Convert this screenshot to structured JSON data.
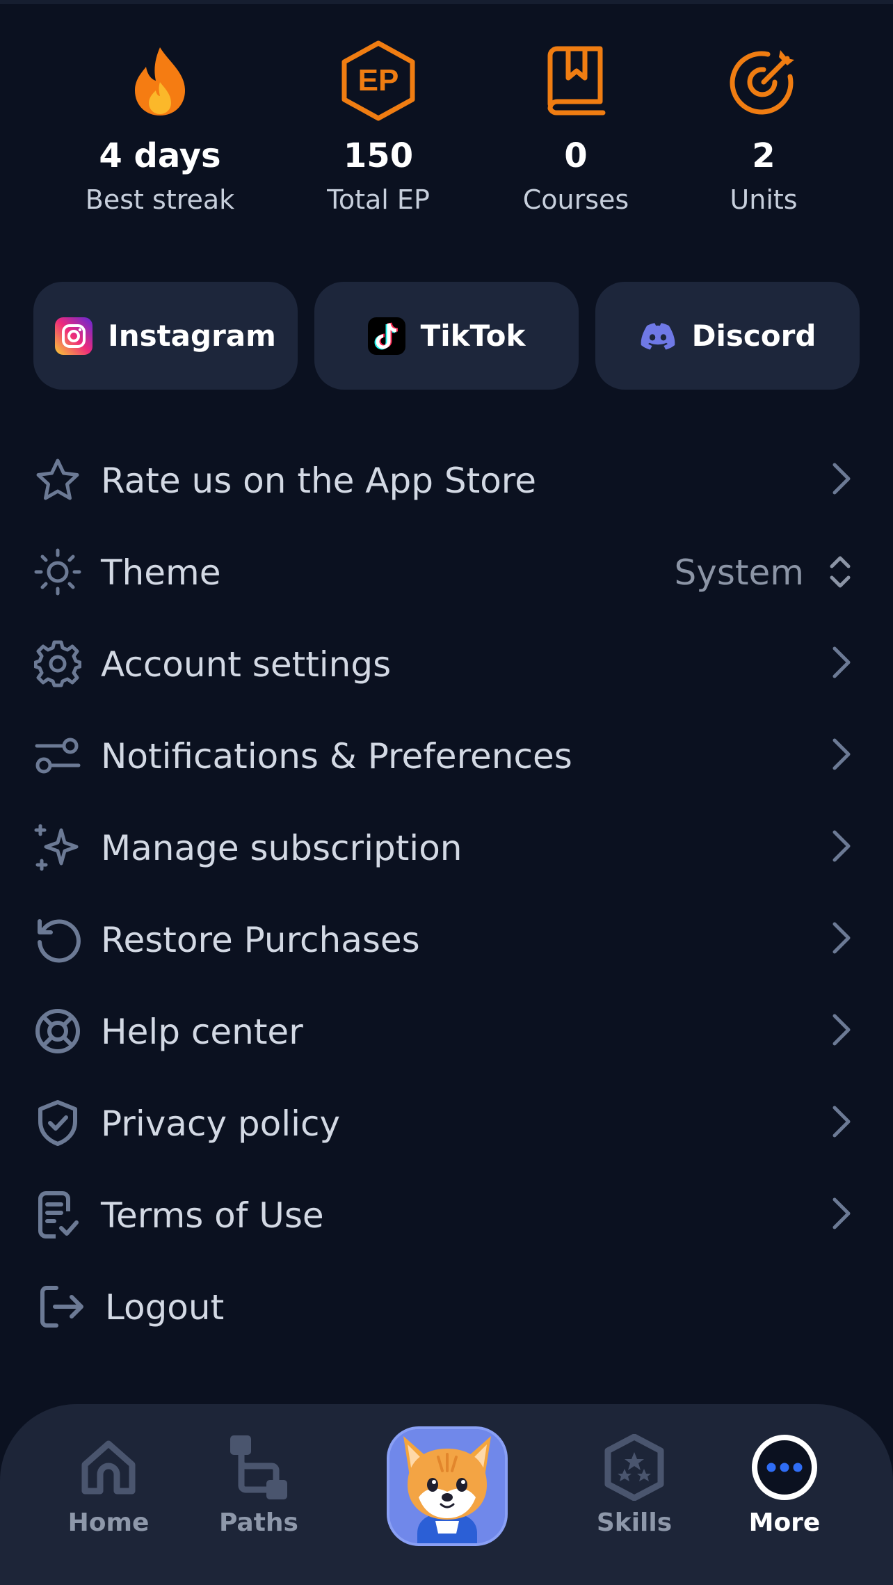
{
  "stats": [
    {
      "value": "4 days",
      "label": "Best streak",
      "icon": "flame-icon"
    },
    {
      "value": "150",
      "label": "Total EP",
      "icon": "ep-hexagon-icon",
      "badge": "EP"
    },
    {
      "value": "0",
      "label": "Courses",
      "icon": "book-bookmark-icon"
    },
    {
      "value": "2",
      "label": "Units",
      "icon": "target-icon"
    }
  ],
  "social": [
    {
      "label": "Instagram",
      "icon": "instagram-icon"
    },
    {
      "label": "TikTok",
      "icon": "tiktok-icon"
    },
    {
      "label": "Discord",
      "icon": "discord-icon"
    }
  ],
  "menu": {
    "rate": "Rate us on the App Store",
    "theme": "Theme",
    "theme_value": "System",
    "account": "Account settings",
    "notifications": "Notifications & Preferences",
    "subscription": "Manage subscription",
    "restore": "Restore Purchases",
    "help": "Help center",
    "privacy": "Privacy policy",
    "terms": "Terms of Use",
    "logout": "Logout"
  },
  "tabs": [
    {
      "label": "Home",
      "icon": "home-icon"
    },
    {
      "label": "Paths",
      "icon": "paths-icon"
    },
    {
      "label": "Skills",
      "icon": "skills-badge-icon"
    },
    {
      "label": "More",
      "icon": "more-icon",
      "active": true
    }
  ],
  "colors": {
    "background": "#0b1120",
    "card": "#1d263b",
    "accent_orange": "#f07d12",
    "active_tab_dot": "#2f6df5"
  }
}
